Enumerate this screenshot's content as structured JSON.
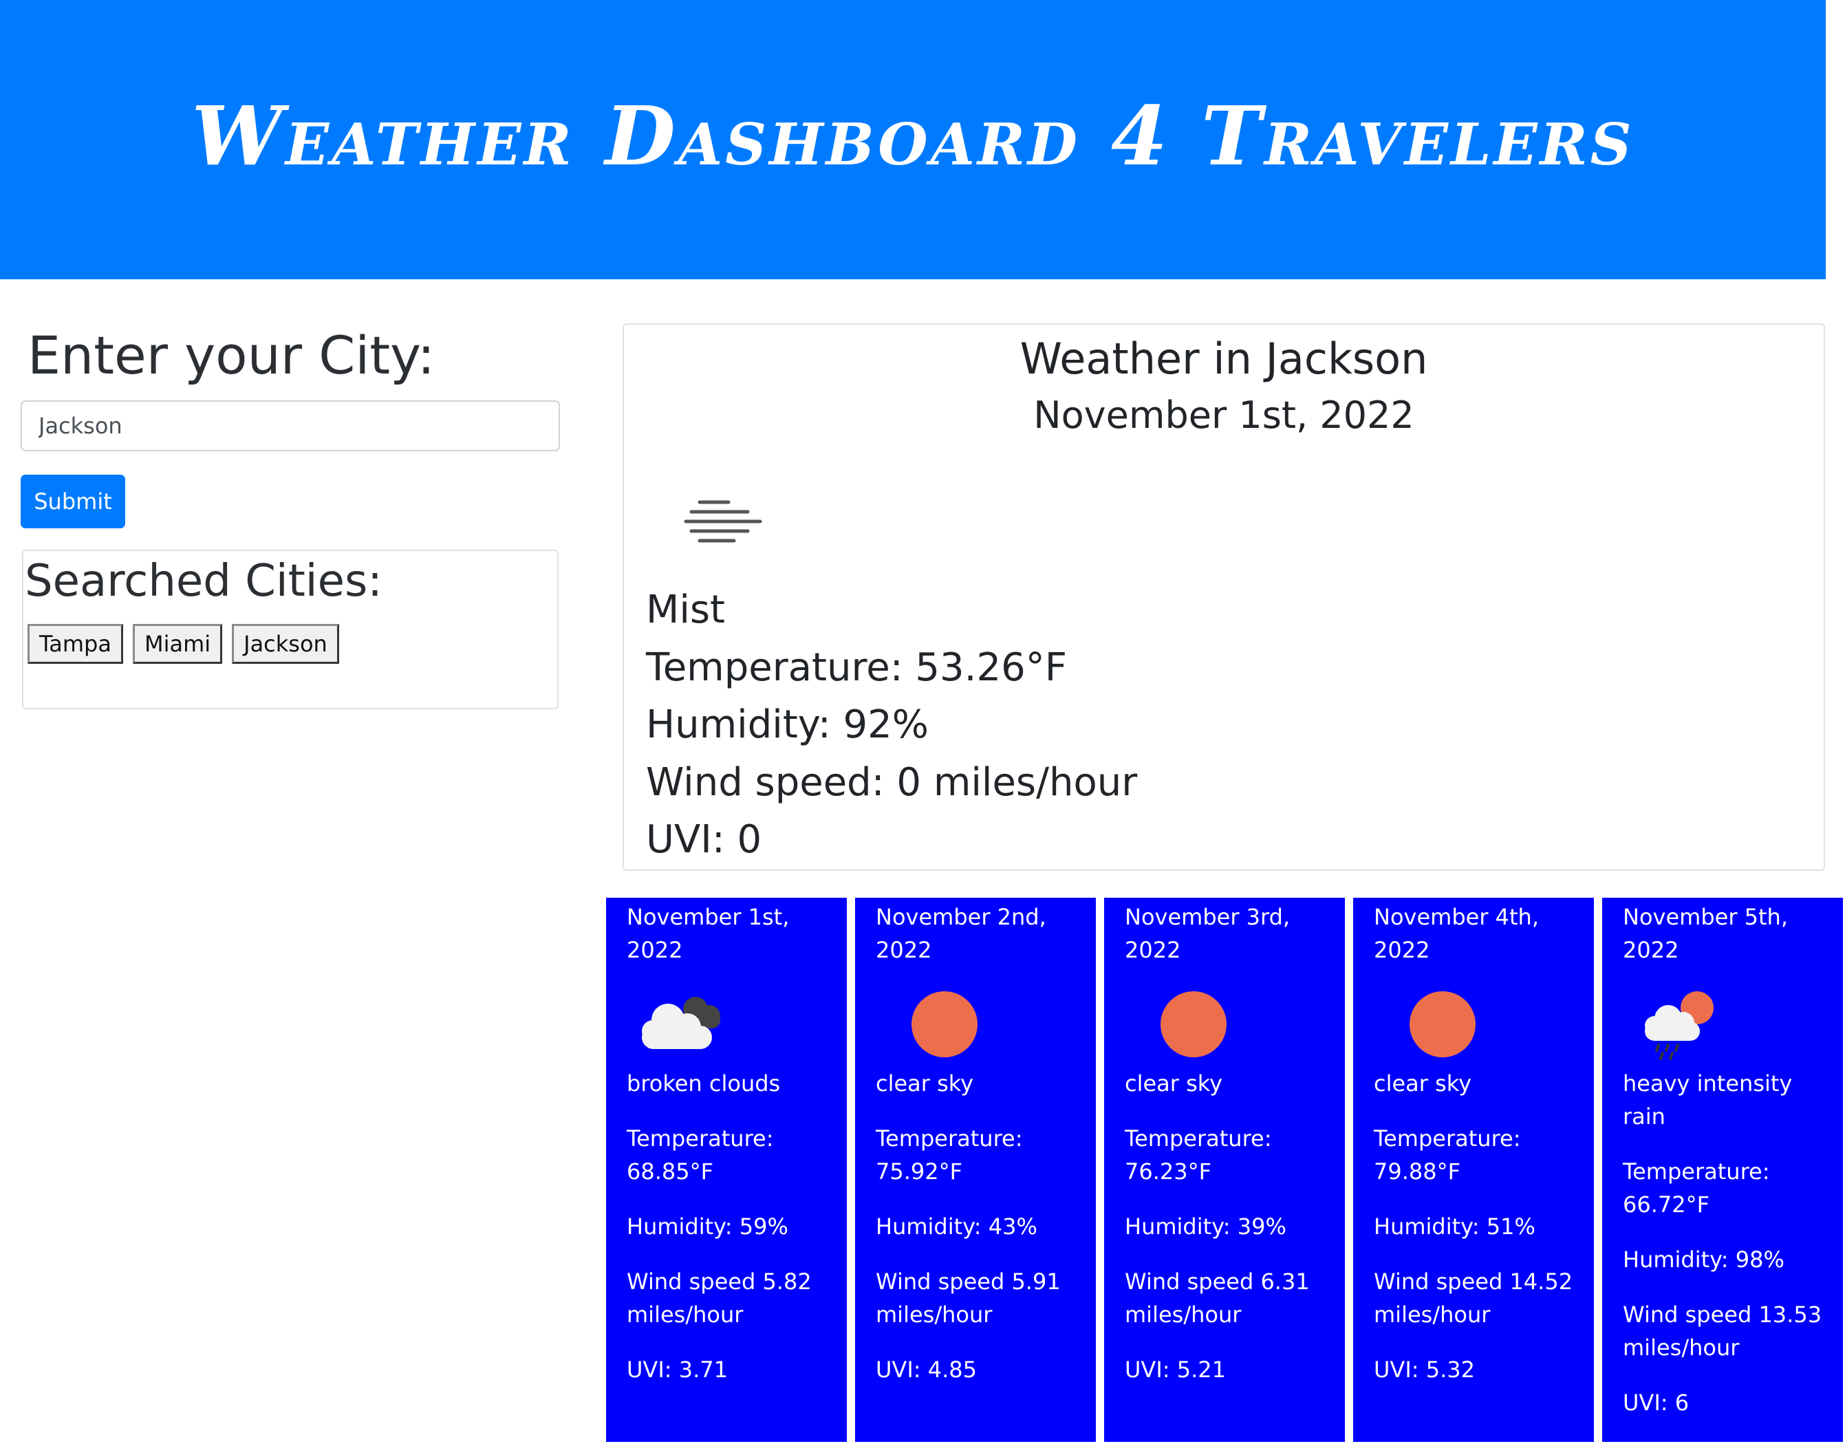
{
  "header": {
    "title": "Weather Dashboard 4 Travelers"
  },
  "search": {
    "heading": "Enter your City:",
    "input_value": "Jackson",
    "submit_label": "Submit",
    "searched_heading": "Searched Cities:",
    "cities": [
      "Tampa",
      "Miami",
      "Jackson"
    ]
  },
  "current": {
    "title": "Weather in Jackson",
    "date": "November 1st, 2022",
    "icon": "mist-icon",
    "description": "Mist",
    "temperature": "Temperature: 53.26°F",
    "humidity": "Humidity: 92%",
    "wind": "Wind speed: 0 miles/hour",
    "uvi": "UVI: 0"
  },
  "forecast": [
    {
      "date": "November 1st, 2022",
      "icon": "broken-clouds-icon",
      "description": "broken clouds",
      "temperature": "Temperature: 68.85°F",
      "humidity": "Humidity: 59%",
      "wind": "Wind speed 5.82 miles/hour",
      "uvi": "UVI: 3.71"
    },
    {
      "date": "November 2nd, 2022",
      "icon": "clear-sky-icon",
      "description": "clear sky",
      "temperature": "Temperature: 75.92°F",
      "humidity": "Humidity: 43%",
      "wind": "Wind speed 5.91 miles/hour",
      "uvi": "UVI: 4.85"
    },
    {
      "date": "November 3rd, 2022",
      "icon": "clear-sky-icon",
      "description": "clear sky",
      "temperature": "Temperature: 76.23°F",
      "humidity": "Humidity: 39%",
      "wind": "Wind speed 6.31 miles/hour",
      "uvi": "UVI: 5.21"
    },
    {
      "date": "November 4th, 2022",
      "icon": "clear-sky-icon",
      "description": "clear sky",
      "temperature": "Temperature: 79.88°F",
      "humidity": "Humidity: 51%",
      "wind": "Wind speed 14.52 miles/hour",
      "uvi": "UVI: 5.32"
    },
    {
      "date": "November 5th, 2022",
      "icon": "heavy-rain-icon",
      "description": "heavy intensity rain",
      "temperature": "Temperature: 66.72°F",
      "humidity": "Humidity: 98%",
      "wind": "Wind speed 13.53 miles/hour",
      "uvi": "UVI: 6"
    }
  ],
  "colors": {
    "header_bg": "#007bff",
    "forecast_bg": "#0000ff",
    "sun": "#ec6e4c",
    "button": "#007bff"
  }
}
